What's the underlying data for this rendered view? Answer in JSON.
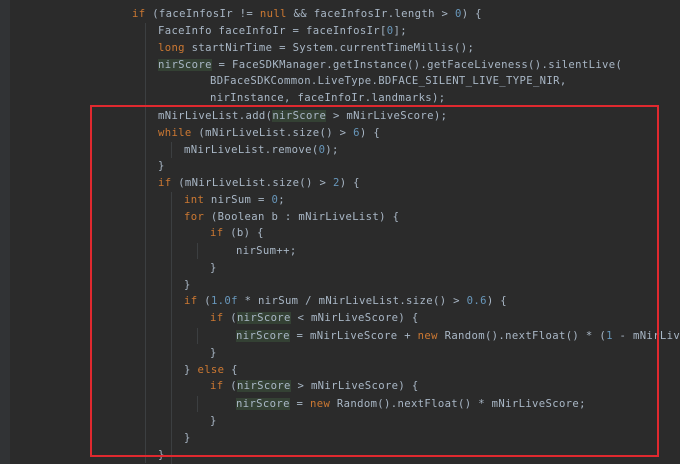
{
  "editor": {
    "language": "java",
    "colors": {
      "background": "#2b2b2b",
      "keyword": "#cc7832",
      "number": "#6897bb",
      "identifier": "#a9b7c6",
      "highlight_bg": "#344134",
      "annotation_box": "#e0292f"
    },
    "lines": [
      {
        "tokens": [
          [
            "kw",
            "if"
          ],
          [
            "p",
            " (faceInfosIr != "
          ],
          [
            "kw",
            "null"
          ],
          [
            "p",
            " && faceInfosIr.length > "
          ],
          [
            "num",
            "0"
          ],
          [
            "p",
            ") {"
          ]
        ]
      },
      {
        "tokens": [
          [
            "p",
            "FaceInfo faceInfoIr = faceInfosIr["
          ],
          [
            "num",
            "0"
          ],
          [
            "p",
            "];"
          ]
        ]
      },
      {
        "tokens": [
          [
            "kw",
            "long"
          ],
          [
            "p",
            " startNirTime = System.currentTimeMillis();"
          ]
        ]
      },
      {
        "tokens": [
          [
            "hl",
            "nirScore"
          ],
          [
            "p",
            " = FaceSDKManager.getInstance().getFaceLiveness().silentLive("
          ]
        ]
      },
      {
        "tokens": [
          [
            "p",
            "BDFaceSDKCommon.LiveType.BDFACE_SILENT_LIVE_TYPE_NIR,"
          ]
        ]
      },
      {
        "tokens": [
          [
            "p",
            "nirInstance, faceInfoIr.landmarks);"
          ]
        ]
      },
      {
        "tokens": [
          [
            "p",
            "mNirLiveList.add("
          ],
          [
            "hl",
            "nirScore"
          ],
          [
            "p",
            " > mNirLiveScore);"
          ]
        ]
      },
      {
        "tokens": [
          [
            "kw",
            "while"
          ],
          [
            "p",
            " (mNirLiveList.size() > "
          ],
          [
            "num",
            "6"
          ],
          [
            "p",
            ") {"
          ]
        ]
      },
      {
        "tokens": [
          [
            "p",
            "mNirLiveList.remove("
          ],
          [
            "num",
            "0"
          ],
          [
            "p",
            ");"
          ]
        ]
      },
      {
        "tokens": [
          [
            "p",
            "}"
          ]
        ]
      },
      {
        "tokens": [
          [
            "kw",
            "if"
          ],
          [
            "p",
            " (mNirLiveList.size() > "
          ],
          [
            "num",
            "2"
          ],
          [
            "p",
            ") {"
          ]
        ]
      },
      {
        "tokens": [
          [
            "kw",
            "int"
          ],
          [
            "p",
            " nirSum = "
          ],
          [
            "num",
            "0"
          ],
          [
            "p",
            ";"
          ]
        ]
      },
      {
        "tokens": [
          [
            "kw",
            "for"
          ],
          [
            "p",
            " (Boolean b : mNirLiveList) {"
          ]
        ]
      },
      {
        "tokens": [
          [
            "kw",
            "if"
          ],
          [
            "p",
            " (b) {"
          ]
        ]
      },
      {
        "tokens": [
          [
            "p",
            "nirSum++;"
          ]
        ]
      },
      {
        "tokens": [
          [
            "p",
            "}"
          ]
        ]
      },
      {
        "tokens": [
          [
            "p",
            "}"
          ]
        ]
      },
      {
        "tokens": [
          [
            "kw",
            "if"
          ],
          [
            "p",
            " ("
          ],
          [
            "num",
            "1.0f"
          ],
          [
            "p",
            " * nirSum / mNirLiveList.size() > "
          ],
          [
            "num",
            "0.6"
          ],
          [
            "p",
            ") {"
          ]
        ]
      },
      {
        "tokens": [
          [
            "kw",
            "if"
          ],
          [
            "p",
            " ("
          ],
          [
            "hl",
            "nirScore"
          ],
          [
            "p",
            " < mNirLiveScore) {"
          ]
        ]
      },
      {
        "tokens": [
          [
            "hl",
            "nirScore"
          ],
          [
            "p",
            " = mNirLiveScore + "
          ],
          [
            "kw",
            "new"
          ],
          [
            "p",
            " Random().nextFloat() * ("
          ],
          [
            "num",
            "1"
          ],
          [
            "p",
            " - mNirLiveS"
          ]
        ]
      },
      {
        "tokens": [
          [
            "p",
            "}"
          ]
        ]
      },
      {
        "tokens": [
          [
            "p",
            "} "
          ],
          [
            "kw",
            "else"
          ],
          [
            "p",
            " {"
          ]
        ]
      },
      {
        "tokens": [
          [
            "kw",
            "if"
          ],
          [
            "p",
            " ("
          ],
          [
            "hl",
            "nirScore"
          ],
          [
            "p",
            " > mNirLiveScore) {"
          ]
        ]
      },
      {
        "tokens": [
          [
            "hl",
            "nirScore"
          ],
          [
            "p",
            " = "
          ],
          [
            "kw",
            "new"
          ],
          [
            "p",
            " Random().nextFloat() * mNirLiveScore;"
          ]
        ]
      },
      {
        "tokens": [
          [
            "p",
            "}"
          ]
        ]
      },
      {
        "tokens": [
          [
            "p",
            "}"
          ]
        ]
      },
      {
        "tokens": [
          [
            "p",
            "}"
          ]
        ]
      }
    ]
  }
}
